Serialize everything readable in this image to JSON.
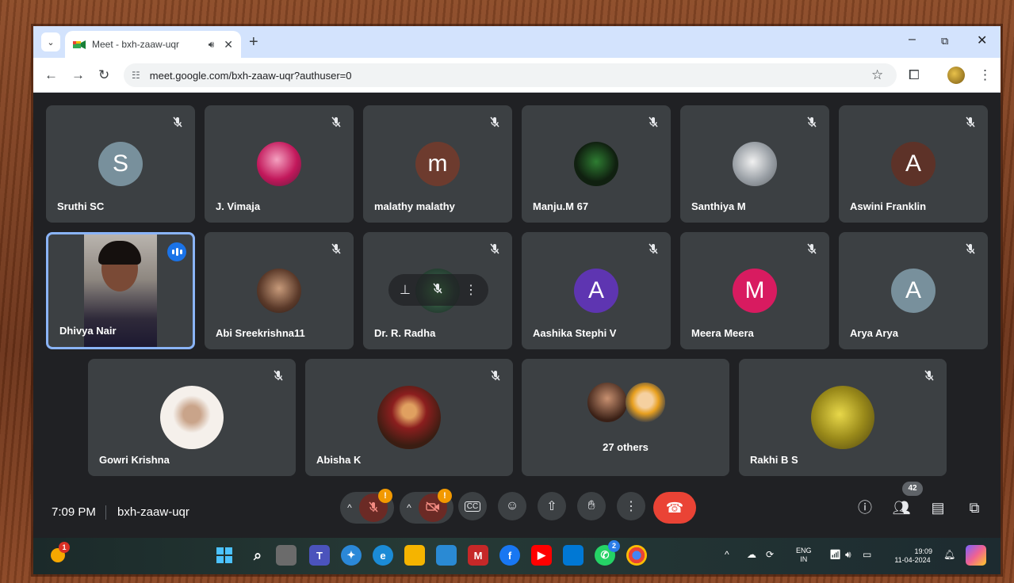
{
  "browser": {
    "tab_title": "Meet - bxh-zaaw-uqr",
    "tab_audio_icon": "speaker-icon",
    "new_tab": "+",
    "url": "meet.google.com/bxh-zaaw-uqr?authuser=0",
    "minimize": "–",
    "restore": "⧉",
    "close": "✕"
  },
  "participants_row1": [
    {
      "name": "Sruthi SC",
      "initial": "S",
      "color": "#78909c"
    },
    {
      "name": "J. Vimaja",
      "initial": "",
      "color": "#c2185b"
    },
    {
      "name": "malathy malathy",
      "initial": "m",
      "color": "#6d3b2e"
    },
    {
      "name": "Manju.M 67",
      "initial": "",
      "color": "#1b2a1b"
    },
    {
      "name": "Santhiya M",
      "initial": "",
      "color": "#9aa0a6"
    },
    {
      "name": "Aswini Franklin",
      "initial": "A",
      "color": "#5d3228"
    }
  ],
  "participants_row2": [
    {
      "name": "Dhivya Nair",
      "initial": "",
      "color": "#5a5a5a"
    },
    {
      "name": "Abi Sreekrishna11",
      "initial": "",
      "color": "#5b3a2a"
    },
    {
      "name": "Dr. R. Radha",
      "initial": "",
      "color": "#2c4a3a"
    },
    {
      "name": "Aashika Stephi V",
      "initial": "A",
      "color": "#5e35b1"
    },
    {
      "name": "Meera Meera",
      "initial": "M",
      "color": "#d81b60"
    },
    {
      "name": "Arya Arya",
      "initial": "A",
      "color": "#78909c"
    }
  ],
  "participants_row3": [
    {
      "name": "Gowri Krishna",
      "initial": "",
      "color": "#f5f0eb"
    },
    {
      "name": "Abisha K",
      "initial": "",
      "color": "#3a1d12"
    },
    {
      "name": "27 others",
      "initial": "",
      "color": "#3c4043"
    },
    {
      "name": "Rakhi B S",
      "initial": "",
      "color": "#9a8a1a"
    }
  ],
  "meetbar": {
    "time": "7:09 PM",
    "meeting_code": "bxh-zaaw-uqr",
    "mic_badge": "!",
    "cam_badge": "!",
    "participant_count": "42"
  },
  "taskbar": {
    "lang": "ENG",
    "lang_region": "IN",
    "clock_time": "19:09",
    "clock_date": "11-04-2024",
    "whatsapp_badge": "2",
    "weather_badge": "1"
  }
}
